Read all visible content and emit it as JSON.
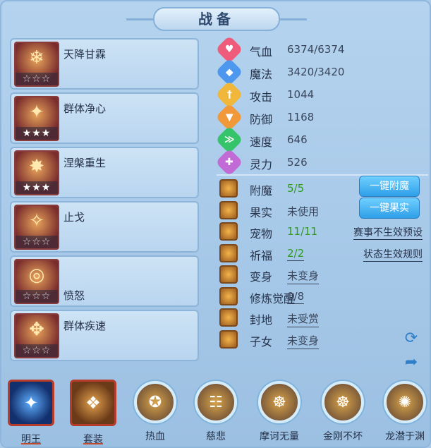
{
  "window": {
    "title": "战备"
  },
  "skills": [
    {
      "name": "天降甘霖",
      "stars": "☆☆☆",
      "filled": false,
      "icon": "popsicle-icon",
      "glyph": "❄"
    },
    {
      "name": "群体净心",
      "stars": "★★★",
      "filled": true,
      "icon": "monk-icon",
      "glyph": "✦"
    },
    {
      "name": "涅槃重生",
      "stars": "★★★",
      "filled": true,
      "icon": "warrior-icon",
      "glyph": "✸"
    },
    {
      "name": "止戈",
      "stars": "☆☆☆",
      "filled": false,
      "icon": "sword-icon",
      "glyph": "✧"
    },
    {
      "name": "愤怒",
      "stars": "☆☆☆",
      "filled": false,
      "icon": "ring-icon",
      "glyph": "◎"
    },
    {
      "name": "群体疾速",
      "stars": "☆☆☆",
      "filled": false,
      "icon": "wings-icon",
      "glyph": "✥"
    }
  ],
  "stats": [
    {
      "label": "气血",
      "value": "6374/6374",
      "icon": "heart-icon",
      "color": "#ef5b7a",
      "glyph": "♥"
    },
    {
      "label": "魔法",
      "value": "3420/3420",
      "icon": "mana-icon",
      "color": "#4e97ef",
      "glyph": "◆"
    },
    {
      "label": "攻击",
      "value": "1044",
      "icon": "attack-icon",
      "color": "#f0b73a",
      "glyph": "†"
    },
    {
      "label": "防御",
      "value": "1168",
      "icon": "defense-icon",
      "color": "#f0983a",
      "glyph": "▼"
    },
    {
      "label": "速度",
      "value": "646",
      "icon": "speed-icon",
      "color": "#36c46b",
      "glyph": "≫"
    },
    {
      "label": "灵力",
      "value": "526",
      "icon": "spirit-icon",
      "color": "#c26bd6",
      "glyph": "✚"
    }
  ],
  "info": [
    {
      "label": "附魔",
      "value": "5/5",
      "green": true,
      "underline": false,
      "icon": "enchant-icon",
      "button": "一键附魔"
    },
    {
      "label": "果实",
      "value": "未使用",
      "green": false,
      "underline": false,
      "icon": "fruit-icon",
      "button": "一键果实"
    },
    {
      "label": "宠物",
      "value": "11/11",
      "green": true,
      "underline": false,
      "icon": "pet-icon",
      "link": "赛事不生效预设"
    },
    {
      "label": "祈福",
      "value": "2/2",
      "green": true,
      "underline": true,
      "icon": "bless-icon",
      "link": "状态生效规则"
    },
    {
      "label": "变身",
      "value": "未变身",
      "green": false,
      "underline": true,
      "icon": "transform-icon"
    },
    {
      "label": "修炼觉醒",
      "value": "0/8",
      "green": false,
      "underline": true,
      "icon": "cultivate-icon"
    },
    {
      "label": "封地",
      "value": "未受赏",
      "green": false,
      "underline": true,
      "icon": "fief-icon"
    },
    {
      "label": "子女",
      "value": "未变身",
      "green": false,
      "underline": true,
      "icon": "child-icon"
    }
  ],
  "bottom": [
    {
      "label": "明王",
      "style": "square",
      "icon": "mingwang-icon",
      "glyph": "✦",
      "selected": true
    },
    {
      "label": "套装",
      "style": "square-bronze",
      "icon": "suit-icon",
      "glyph": "❖",
      "selected": true
    },
    {
      "label": "热血",
      "style": "circle",
      "icon": "rexue-icon",
      "glyph": "✪"
    },
    {
      "label": "慈悲",
      "style": "circle",
      "icon": "cibei-icon",
      "glyph": "☷"
    },
    {
      "label": "摩诃无量",
      "style": "circle",
      "icon": "mohe-icon",
      "glyph": "☸"
    },
    {
      "label": "金刚不坏",
      "style": "circle",
      "icon": "jingang-icon",
      "glyph": "☸"
    },
    {
      "label": "龙潜于渊",
      "style": "circle",
      "icon": "longqian-icon",
      "glyph": "✺"
    }
  ]
}
